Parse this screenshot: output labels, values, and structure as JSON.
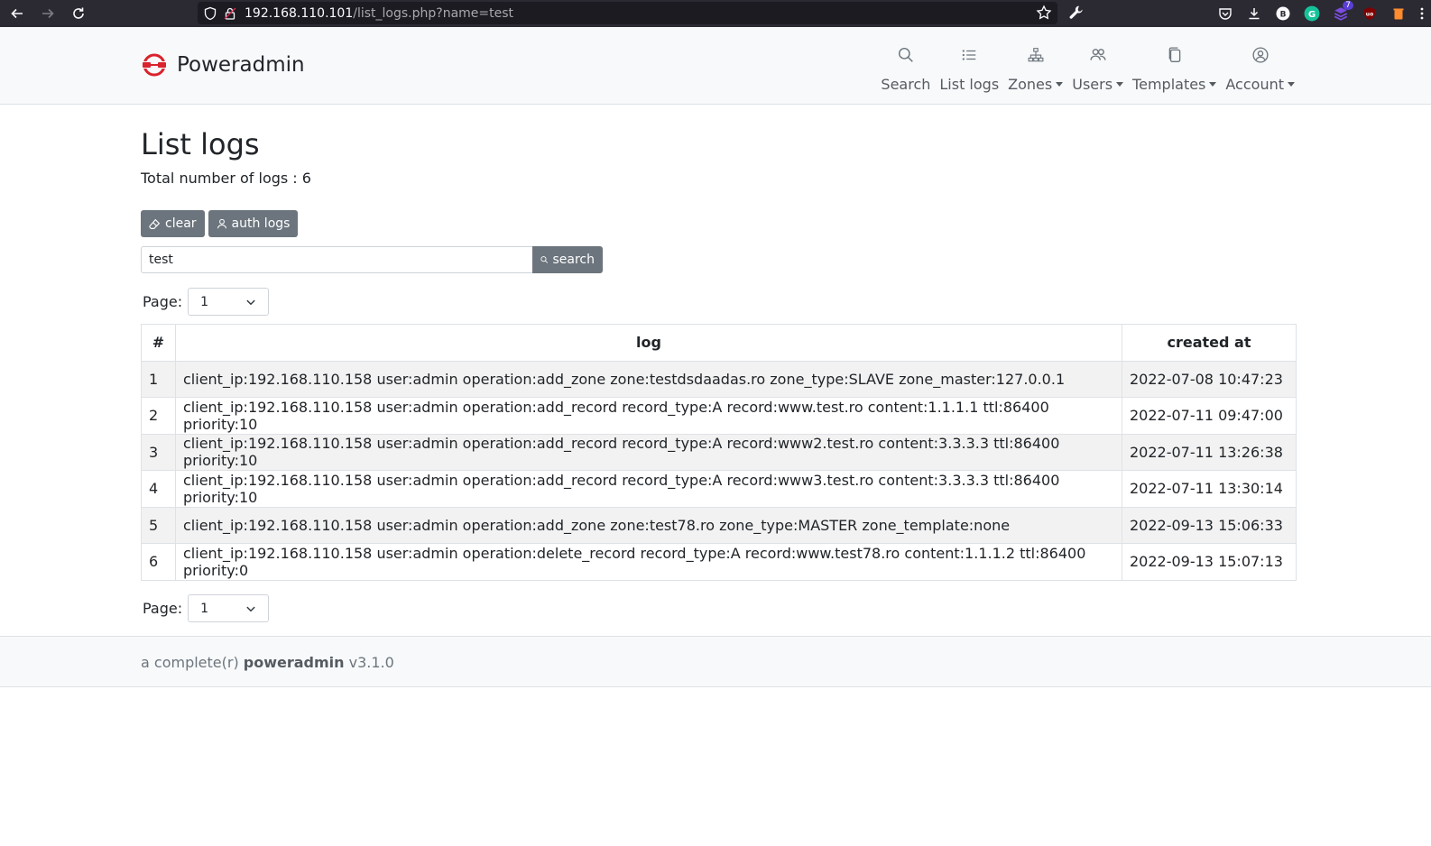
{
  "browser": {
    "url_host": "192.168.110.101",
    "url_path": "/list_logs.php?name=test",
    "extension_badge": "7"
  },
  "header": {
    "brand": "Poweradmin",
    "nav": [
      {
        "label": "Search",
        "icon": "search-icon",
        "dropdown": false
      },
      {
        "label": "List logs",
        "icon": "list-icon",
        "dropdown": false
      },
      {
        "label": "Zones",
        "icon": "sitemap-icon",
        "dropdown": true
      },
      {
        "label": "Users",
        "icon": "users-icon",
        "dropdown": true
      },
      {
        "label": "Templates",
        "icon": "copy-icon",
        "dropdown": true
      },
      {
        "label": "Account",
        "icon": "person-circle-icon",
        "dropdown": true
      }
    ]
  },
  "page": {
    "title": "List logs",
    "total_label": "Total number of logs : 6",
    "buttons": {
      "clear": "clear",
      "auth_logs": "auth logs"
    },
    "search": {
      "value": "test",
      "button": "search"
    },
    "pager_label": "Page:",
    "pager_value": "1"
  },
  "table": {
    "headers": [
      "#",
      "log",
      "created at"
    ],
    "rows": [
      {
        "n": "1",
        "log": "client_ip:192.168.110.158 user:admin operation:add_zone zone:testdsdaadas.ro zone_type:SLAVE zone_master:127.0.0.1",
        "created": "2022-07-08 10:47:23"
      },
      {
        "n": "2",
        "log": "client_ip:192.168.110.158 user:admin operation:add_record record_type:A record:www.test.ro content:1.1.1.1 ttl:86400 priority:10",
        "created": "2022-07-11 09:47:00"
      },
      {
        "n": "3",
        "log": "client_ip:192.168.110.158 user:admin operation:add_record record_type:A record:www2.test.ro content:3.3.3.3 ttl:86400 priority:10",
        "created": "2022-07-11 13:26:38"
      },
      {
        "n": "4",
        "log": "client_ip:192.168.110.158 user:admin operation:add_record record_type:A record:www3.test.ro content:3.3.3.3 ttl:86400 priority:10",
        "created": "2022-07-11 13:30:14"
      },
      {
        "n": "5",
        "log": "client_ip:192.168.110.158 user:admin operation:add_zone zone:test78.ro zone_type:MASTER zone_template:none",
        "created": "2022-09-13 15:06:33"
      },
      {
        "n": "6",
        "log": "client_ip:192.168.110.158 user:admin operation:delete_record record_type:A record:www.test78.ro content:1.1.1.2 ttl:86400 priority:0",
        "created": "2022-09-13 15:07:13"
      }
    ]
  },
  "footer": {
    "prefix": "a complete(r)",
    "name": "poweradmin",
    "version": "v3.1.0"
  },
  "colors": {
    "brand_red": "#d9232d",
    "button_gray": "#6c757d",
    "header_bg": "#f8f9fa",
    "browser_bg": "#2b2a33"
  }
}
